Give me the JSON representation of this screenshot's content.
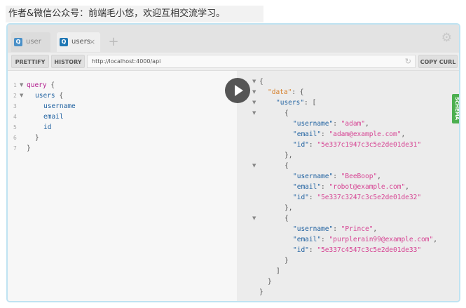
{
  "caption": "作者&微信公众号：前端毛小悠，欢迎互相交流学习。",
  "tabs": [
    {
      "badge": "Q",
      "label": "user"
    },
    {
      "badge": "Q",
      "label": "users",
      "close": "×"
    }
  ],
  "new_tab": "+",
  "toolbar": {
    "prettify": "PRETTIFY",
    "history": "HISTORY",
    "url": "http://localhost:4000/api",
    "copy_curl": "COPY CURL"
  },
  "schema_label": "SCHEMA",
  "query_lines": [
    "1",
    "2",
    "3",
    "4",
    "5",
    "6",
    "7"
  ],
  "query": {
    "keyword": "query",
    "field": "users",
    "f1": "username",
    "f2": "email",
    "f3": "id"
  },
  "result": {
    "data_key": "\"data\"",
    "users_key": "\"users\"",
    "users": [
      {
        "username": "\"adam\"",
        "email": "\"adam@example.com\"",
        "id": "\"5e337c1947c3c5e2de01de31\""
      },
      {
        "username": "\"BeeBoop\"",
        "email": "\"robot@example.com\"",
        "id": "\"5e337c3247c3c5e2de01de32\""
      },
      {
        "username": "\"Prince\"",
        "email": "\"purplerain99@example.com\"",
        "id": "\"5e337c4547c3c5e2de01de33\""
      }
    ]
  }
}
